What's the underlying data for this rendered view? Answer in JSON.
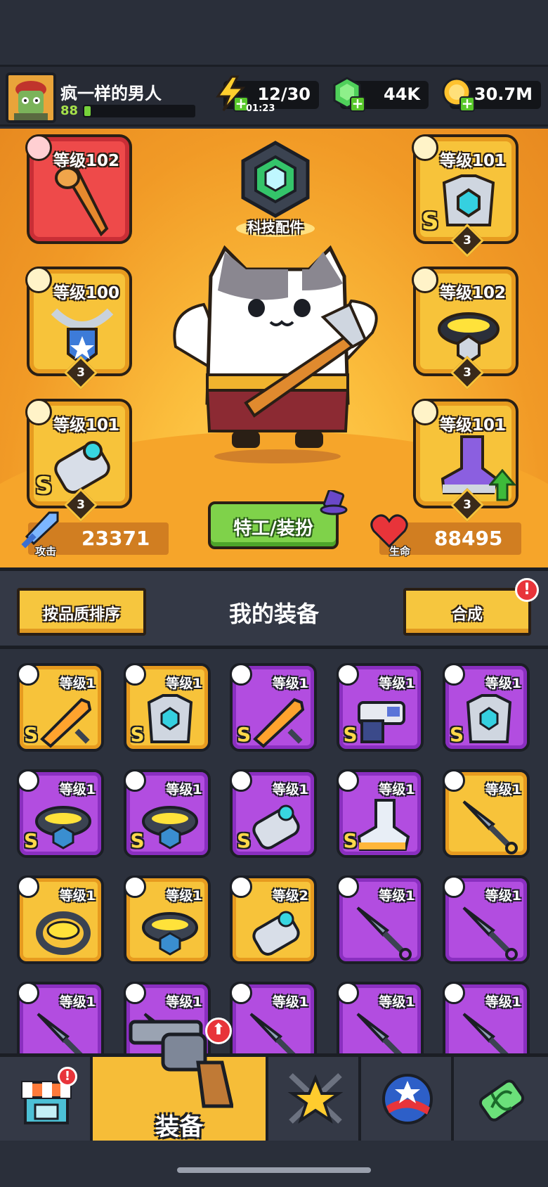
{
  "header": {
    "username": "疯一样的男人",
    "player_level": "88",
    "xp_fraction": 0.06,
    "energy": "12/30",
    "energy_timer": "01:23",
    "gems": "44K",
    "coins": "30.7M"
  },
  "hero": {
    "tech_label": "科技配件",
    "agent_button": "特工/装扮",
    "attack_label": "攻击",
    "attack_value": "23371",
    "hp_label": "生命",
    "hp_value": "88495",
    "slots": [
      {
        "level": "等级102",
        "color": "red",
        "grade": "",
        "stars": "",
        "icon": "bat-weapon-icon"
      },
      {
        "level": "等级101",
        "color": "gold",
        "grade": "S",
        "stars": "3",
        "icon": "armor-chest-icon"
      },
      {
        "level": "等级100",
        "color": "gold",
        "grade": "",
        "stars": "3",
        "icon": "necklace-icon"
      },
      {
        "level": "等级102",
        "color": "gold",
        "grade": "",
        "stars": "3",
        "icon": "belt-icon"
      },
      {
        "level": "等级101",
        "color": "gold",
        "grade": "S",
        "stars": "3",
        "icon": "gauntlet-icon"
      },
      {
        "level": "等级101",
        "color": "gold",
        "grade": "",
        "stars": "3",
        "icon": "boot-icon"
      }
    ]
  },
  "equipment": {
    "sort_button": "按品质排序",
    "title": "我的装备",
    "merge_button": "合成",
    "merge_badge": "!",
    "items": [
      {
        "level": "等级1",
        "color": "gold",
        "grade": "S",
        "icon": "sword-icon"
      },
      {
        "level": "等级1",
        "color": "gold",
        "grade": "S",
        "icon": "armor-chest-icon"
      },
      {
        "level": "等级1",
        "color": "purple",
        "grade": "S",
        "icon": "sword-icon"
      },
      {
        "level": "等级1",
        "color": "purple",
        "grade": "S",
        "icon": "blaster-icon"
      },
      {
        "level": "等级1",
        "color": "purple",
        "grade": "S",
        "icon": "armor-chest-icon"
      },
      {
        "level": "等级1",
        "color": "purple",
        "grade": "S",
        "icon": "belt-icon"
      },
      {
        "level": "等级1",
        "color": "purple",
        "grade": "S",
        "icon": "belt-icon"
      },
      {
        "level": "等级1",
        "color": "purple",
        "grade": "S",
        "icon": "gauntlet-icon"
      },
      {
        "level": "等级1",
        "color": "purple",
        "grade": "S",
        "icon": "boot-icon"
      },
      {
        "level": "等级1",
        "color": "gold",
        "grade": "",
        "icon": "kunai-icon"
      },
      {
        "level": "等级1",
        "color": "gold",
        "grade": "",
        "icon": "necklace-icon"
      },
      {
        "level": "等级1",
        "color": "gold",
        "grade": "",
        "icon": "belt-icon"
      },
      {
        "level": "等级2",
        "color": "gold",
        "grade": "",
        "icon": "gauntlet-icon"
      },
      {
        "level": "等级1",
        "color": "purple",
        "grade": "",
        "icon": "kunai-icon"
      },
      {
        "level": "等级1",
        "color": "purple",
        "grade": "",
        "icon": "kunai-icon"
      },
      {
        "level": "等级1",
        "color": "purple",
        "grade": "",
        "icon": "kunai-icon"
      },
      {
        "level": "等级1",
        "color": "purple",
        "grade": "",
        "icon": "kunai-icon"
      },
      {
        "level": "等级1",
        "color": "purple",
        "grade": "",
        "icon": "kunai-icon"
      },
      {
        "level": "等级1",
        "color": "purple",
        "grade": "",
        "icon": "kunai-icon"
      },
      {
        "level": "等级1",
        "color": "purple",
        "grade": "",
        "icon": "kunai-icon"
      }
    ]
  },
  "nav": {
    "active_label": "装备",
    "shop_badge": "!",
    "items": [
      "shop-icon",
      "revolver-icon",
      "crossed-swords-star-icon",
      "stars-ball-icon",
      "dna-capsule-icon"
    ]
  },
  "colors": {
    "gold": "#f7c33a",
    "purple": "#b24de0",
    "red": "#ee4a4a",
    "green": "#7fd24a"
  }
}
